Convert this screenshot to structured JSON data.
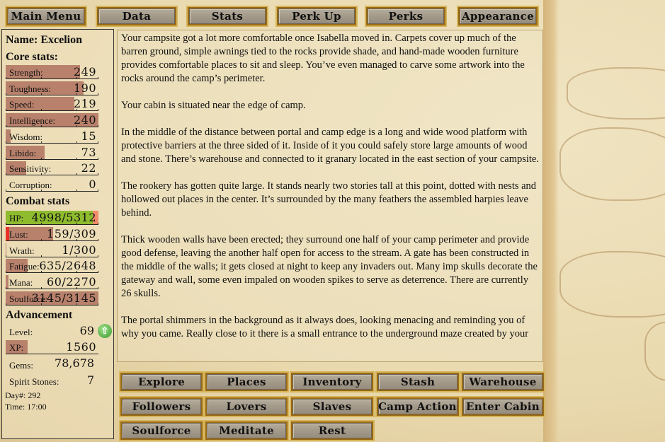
{
  "top_nav": [
    "Main Menu",
    "Data",
    "Stats",
    "Perk Up",
    "Perks",
    "Appearance"
  ],
  "stats_panel": {
    "name_label": "Name: Excelion",
    "core_heading": "Core stats:",
    "core": [
      {
        "label": "Strength:",
        "value": "249",
        "fill": 0.8
      },
      {
        "label": "Toughness:",
        "value": "190",
        "fill": 0.84
      },
      {
        "label": "Speed:",
        "value": "219",
        "fill": 0.74
      },
      {
        "label": "Intelligence:",
        "value": "240",
        "fill": 1.0
      },
      {
        "label": "Wisdom:",
        "value": "15",
        "fill": 0.05
      },
      {
        "label": "Libido:",
        "value": "73",
        "fill": 0.42
      },
      {
        "label": "Sensitivity:",
        "value": "22",
        "fill": 0.22
      },
      {
        "label": "Corruption:",
        "value": "0",
        "fill": 0.0
      }
    ],
    "combat_heading": "Combat stats",
    "combat": [
      {
        "label": "HP:",
        "value": "4998/5312",
        "fill": 0.94,
        "kind": "hp"
      },
      {
        "label": "Lust:",
        "value": "159/309",
        "fill": 0.51,
        "kind": "lust"
      },
      {
        "label": "Wrath:",
        "value": "1/300",
        "fill": 0.003,
        "kind": "normal"
      },
      {
        "label": "Fatigue:",
        "value": "635/2648",
        "fill": 0.24,
        "kind": "normal"
      },
      {
        "label": "Mana:",
        "value": "60/2270",
        "fill": 0.03,
        "kind": "normal"
      },
      {
        "label": "Soulforce:",
        "value": "3145/3145",
        "fill": 1.0,
        "kind": "normal"
      }
    ],
    "advancement_heading": "Advancement",
    "level_label": "Level:",
    "level_value": "69",
    "level_up_icon": "level-up-arrow-icon",
    "xp_label": "XP:",
    "xp_value": "1560",
    "xp_fill": 0.24,
    "gems_label": "Gems:",
    "gems_value": "78,678",
    "spirit_label": "Spirit Stones:",
    "spirit_value": "7",
    "day": "Day#: 292",
    "time": "Time: 17:00"
  },
  "main_text": [
    "Your campsite got a lot more comfortable once Isabella moved in. Carpets cover up much of the barren ground, simple awnings tied to the rocks provide shade, and hand-made wooden furniture provides comfortable places to sit and sleep. You’ve even managed to carve some artwork into the rocks around the camp’s perimeter.",
    "Your cabin is situated near the edge of camp.",
    "In the middle of the distance between portal and camp edge is a long and wide wood platform with protective barriers at the three sided of it. Inside of it you could safely store large amounts of wood and stone. There’s warehouse and connected to it granary located in the east section of your campsite.",
    "The rookery has gotten quite large. It stands nearly two stories tall at this point, dotted with nests and hollowed out places in the center. It’s surrounded by the many feathers the assembled harpies leave behind.",
    "Thick wooden walls have been erected; they surround one half of your camp perimeter and provide good defense, leaving the another half open for access to the stream. A gate has been constructed in the middle of the walls; it gets closed at night to keep any invaders out. Many imp skulls decorate the gateway and wall, some even impaled on wooden spikes to serve as deterrence. There are currently 26 skulls.",
    "The portal shimmers in the background as it always does, looking menacing and reminding you of why you came. Really close to it there is a small entrance to the underground maze created by your"
  ],
  "actions": [
    [
      "Explore",
      "Places",
      "Inventory",
      "Stash",
      "Warehouse"
    ],
    [
      "Followers",
      "Lovers",
      "Slaves",
      "Camp Actions",
      "Enter Cabin"
    ],
    [
      "Soulforce",
      "Meditate",
      "Rest"
    ]
  ],
  "colors": {
    "stat_bar": "#b37764",
    "hp_bar": "#8fbb2e",
    "hp_missing": "#f28a6a",
    "lust_min": "#e8302a",
    "button_face": "#a49a8a",
    "button_border": "#9a6a14"
  }
}
